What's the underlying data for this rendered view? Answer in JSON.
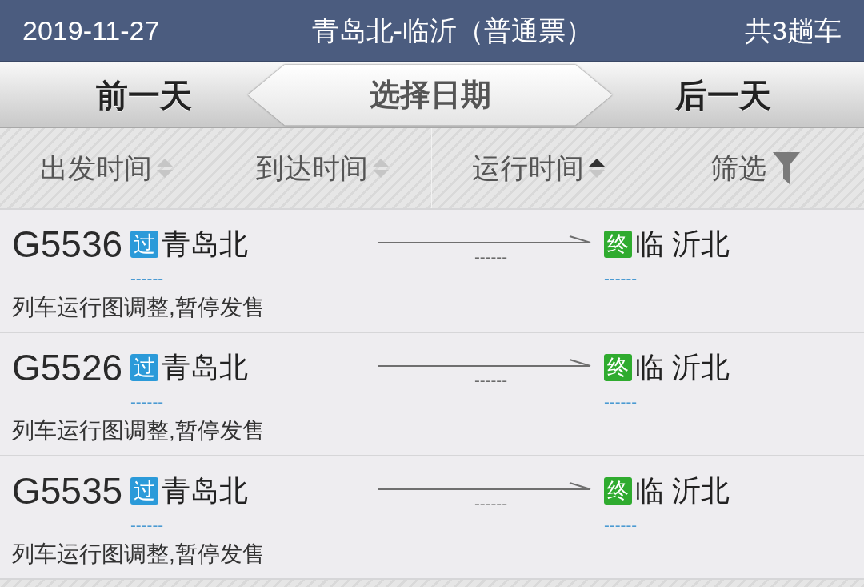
{
  "header": {
    "date": "2019-11-27",
    "title": "青岛北-临沂（普通票）",
    "count": "共3趟车"
  },
  "date_nav": {
    "previous": "前一天",
    "select": "选择日期",
    "next": "后一天"
  },
  "sort_bar": [
    {
      "kind": "sort",
      "label": "出发时间",
      "selected": false
    },
    {
      "kind": "sort",
      "label": "到达时间",
      "selected": false
    },
    {
      "kind": "sort",
      "label": "运行时间",
      "selected": true,
      "ascending": true
    },
    {
      "kind": "filter",
      "label": "筛选"
    }
  ],
  "trains": [
    {
      "number": "G5536",
      "origin": {
        "badge": "过",
        "name": "青岛北",
        "time": "------"
      },
      "duration": "------",
      "destination": {
        "badge": "终",
        "name": "临 沂北",
        "time": "------"
      },
      "status": "列车运行图调整,暂停发售"
    },
    {
      "number": "G5526",
      "origin": {
        "badge": "过",
        "name": "青岛北",
        "time": "------"
      },
      "duration": "------",
      "destination": {
        "badge": "终",
        "name": "临 沂北",
        "time": "------"
      },
      "status": "列车运行图调整,暂停发售"
    },
    {
      "number": "G5535",
      "origin": {
        "badge": "过",
        "name": "青岛北",
        "time": "------"
      },
      "duration": "------",
      "destination": {
        "badge": "终",
        "name": "临 沂北",
        "time": "------"
      },
      "status": "列车运行图调整,暂停发售"
    }
  ]
}
